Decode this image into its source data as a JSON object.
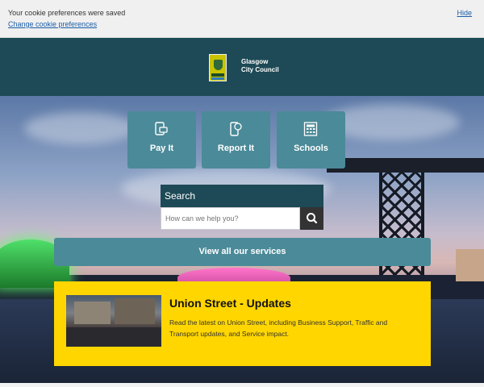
{
  "cookie_banner": {
    "message": "Your cookie preferences were saved",
    "change_link": "Change cookie preferences",
    "hide_link": "Hide"
  },
  "header": {
    "brand_line1": "Glasgow",
    "brand_line2": "City Council",
    "logo_icon": "glasgow-city-council-crest"
  },
  "quick_links": [
    {
      "label": "Pay It",
      "icon": "pay-card-icon"
    },
    {
      "label": "Report It",
      "icon": "report-phone-icon"
    },
    {
      "label": "Schools",
      "icon": "calculator-icon"
    }
  ],
  "search": {
    "title": "Search",
    "placeholder": "How can we help you?",
    "button_icon": "search-icon"
  },
  "services_button": "View all our services",
  "feature": {
    "title": "Union Street - Updates",
    "description": "Read the latest on Union Street, including Business Support, Traffic and Transport updates, and Service impact."
  },
  "colors": {
    "header_bg": "#1d4a56",
    "tile_bg": "#4b8a98",
    "feature_bg": "#ffd600",
    "link": "#1a5ea8"
  }
}
